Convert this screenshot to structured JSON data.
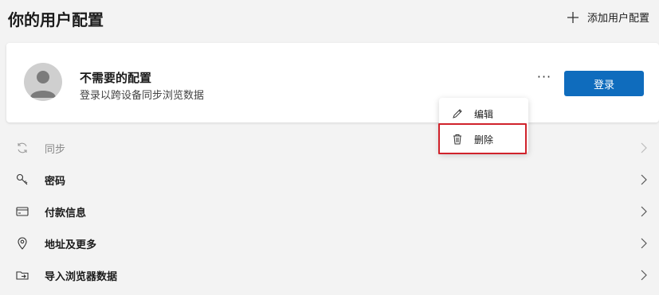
{
  "page": {
    "title": "你的用户配置",
    "add_profile_label": "添加用户配置"
  },
  "profile": {
    "name": "不需要的配置",
    "subtitle": "登录以跨设备同步浏览数据",
    "more_label": "···",
    "login_label": "登录"
  },
  "context_menu": {
    "items": [
      {
        "label": "编辑",
        "icon": "pencil-icon"
      },
      {
        "label": "删除",
        "icon": "trash-icon"
      }
    ]
  },
  "settings": {
    "items": [
      {
        "label": "同步",
        "icon": "sync-icon",
        "enabled": false
      },
      {
        "label": "密码",
        "icon": "key-icon",
        "enabled": true
      },
      {
        "label": "付款信息",
        "icon": "card-icon",
        "enabled": true
      },
      {
        "label": "地址及更多",
        "icon": "location-pin-icon",
        "enabled": true
      },
      {
        "label": "导入浏览器数据",
        "icon": "import-icon",
        "enabled": true
      }
    ]
  },
  "colors": {
    "background": "#f3f3f3",
    "card": "#ffffff",
    "accent_button": "#0f6cbd",
    "highlight_border": "#d0222b",
    "disabled_text": "#8a8a8a"
  }
}
